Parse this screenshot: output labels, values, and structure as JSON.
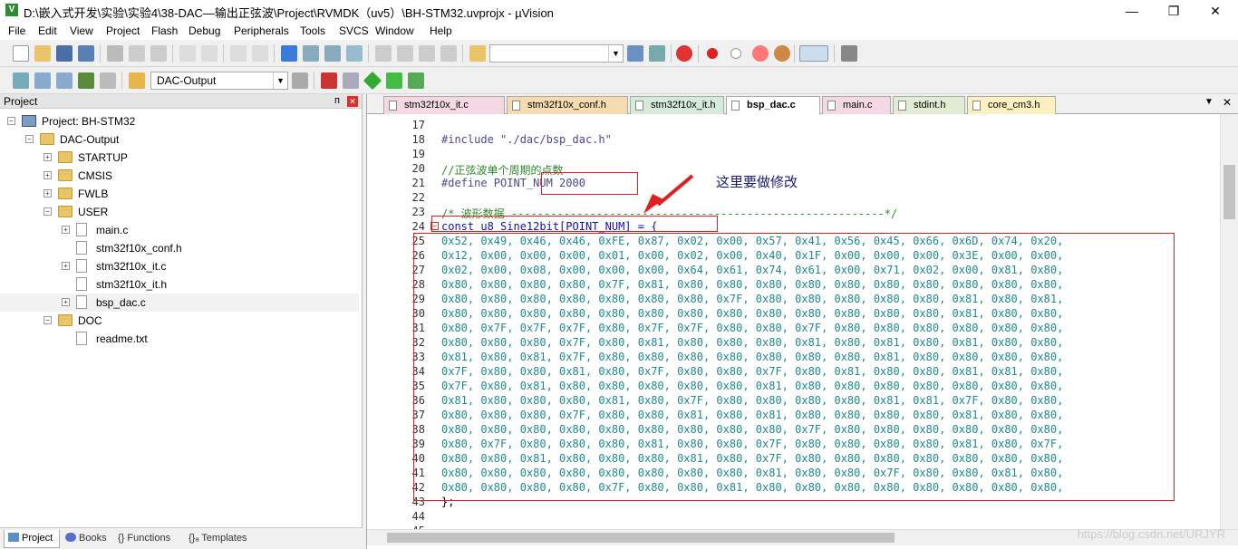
{
  "window": {
    "title": "D:\\嵌入式开发\\实验\\实验4\\38-DAC—输出正弦波\\Project\\RVMDK（uv5）\\BH-STM32.uvprojx - µVision",
    "minimize": "—",
    "restore": "❐",
    "close": "✕"
  },
  "menu": [
    "File",
    "Edit",
    "View",
    "Project",
    "Flash",
    "Debug",
    "Peripherals",
    "Tools",
    "SVCS",
    "Window",
    "Help"
  ],
  "toolbar": {
    "target_select": "DAC-Output"
  },
  "project_panel": {
    "title": "Project",
    "pin": "ᴨ",
    "close": "✕",
    "tree": [
      {
        "label": "Project: BH-STM32",
        "level": 0,
        "expand": "−",
        "icon": "project-icon"
      },
      {
        "label": "DAC-Output",
        "level": 1,
        "expand": "−",
        "icon": "folder-icon"
      },
      {
        "label": "STARTUP",
        "level": 2,
        "expand": "+",
        "icon": "folder-icon"
      },
      {
        "label": "CMSIS",
        "level": 2,
        "expand": "+",
        "icon": "folder-icon"
      },
      {
        "label": "FWLB",
        "level": 2,
        "expand": "+",
        "icon": "folder-icon"
      },
      {
        "label": "USER",
        "level": 2,
        "expand": "−",
        "icon": "folder-icon"
      },
      {
        "label": "main.c",
        "level": 3,
        "expand": "+",
        "icon": "file-icon"
      },
      {
        "label": "stm32f10x_conf.h",
        "level": 3,
        "expand": "",
        "icon": "file-icon"
      },
      {
        "label": "stm32f10x_it.c",
        "level": 3,
        "expand": "+",
        "icon": "file-icon"
      },
      {
        "label": "stm32f10x_it.h",
        "level": 3,
        "expand": "",
        "icon": "file-icon"
      },
      {
        "label": "bsp_dac.c",
        "level": 3,
        "expand": "+",
        "icon": "file-icon"
      },
      {
        "label": "DOC",
        "level": 2,
        "expand": "−",
        "icon": "folder-icon"
      },
      {
        "label": "readme.txt",
        "level": 3,
        "expand": "",
        "icon": "file-icon"
      }
    ],
    "bottom_tabs": [
      "Project",
      "Books",
      "{} Functions",
      "{}ₐ Templates"
    ]
  },
  "editor": {
    "tabs": [
      {
        "label": "stm32f10x_it.c",
        "color": "#f4d9e4"
      },
      {
        "label": "stm32f10x_conf.h",
        "color": "#f7dbb0"
      },
      {
        "label": "stm32f10x_it.h",
        "color": "#d5ead9"
      },
      {
        "label": "bsp_dac.c",
        "color": "#ffffff",
        "active": true
      },
      {
        "label": "main.c",
        "color": "#f4d9e4"
      },
      {
        "label": "stdint.h",
        "color": "#e2ecd2"
      },
      {
        "label": "core_cm3.h",
        "color": "#fbf0c0"
      }
    ],
    "lines": [
      {
        "n": "17",
        "text": "",
        "cls": "c-plain"
      },
      {
        "n": "18",
        "text": "#include \"./dac/bsp_dac.h\"",
        "cls": "c-pre"
      },
      {
        "n": "19",
        "text": "",
        "cls": "c-plain"
      },
      {
        "n": "20",
        "text": "//正弦波单个周期的点数",
        "cls": "c-comment"
      },
      {
        "n": "21",
        "text": "#define POINT_NUM 2000",
        "cls": "c-pre"
      },
      {
        "n": "22",
        "text": "",
        "cls": "c-plain"
      },
      {
        "n": "23",
        "text": "/* 波形数据 ---------------------------------------------------------*/",
        "cls": "c-comment"
      },
      {
        "n": "24",
        "text": "const u8 Sine12bit[POINT_NUM] = {",
        "cls": "c-kw",
        "fold": "−"
      },
      {
        "n": "25",
        "text": "0x52, 0x49, 0x46, 0x46, 0xFE, 0x87, 0x02, 0x00, 0x57, 0x41, 0x56, 0x45, 0x66, 0x6D, 0x74, 0x20,",
        "cls": "c-hex"
      },
      {
        "n": "26",
        "text": "0x12, 0x00, 0x00, 0x00, 0x01, 0x00, 0x02, 0x00, 0x40, 0x1F, 0x00, 0x00, 0x00, 0x3E, 0x00, 0x00,",
        "cls": "c-hex"
      },
      {
        "n": "27",
        "text": "0x02, 0x00, 0x08, 0x00, 0x00, 0x00, 0x64, 0x61, 0x74, 0x61, 0x00, 0x71, 0x02, 0x00, 0x81, 0x80,",
        "cls": "c-hex"
      },
      {
        "n": "28",
        "text": "0x80, 0x80, 0x80, 0x80, 0x7F, 0x81, 0x80, 0x80, 0x80, 0x80, 0x80, 0x80, 0x80, 0x80, 0x80, 0x80,",
        "cls": "c-hex"
      },
      {
        "n": "29",
        "text": "0x80, 0x80, 0x80, 0x80, 0x80, 0x80, 0x80, 0x7F, 0x80, 0x80, 0x80, 0x80, 0x80, 0x81, 0x80, 0x81,",
        "cls": "c-hex"
      },
      {
        "n": "30",
        "text": "0x80, 0x80, 0x80, 0x80, 0x80, 0x80, 0x80, 0x80, 0x80, 0x80, 0x80, 0x80, 0x80, 0x81, 0x80, 0x80,",
        "cls": "c-hex"
      },
      {
        "n": "31",
        "text": "0x80, 0x7F, 0x7F, 0x7F, 0x80, 0x7F, 0x7F, 0x80, 0x80, 0x7F, 0x80, 0x80, 0x80, 0x80, 0x80, 0x80,",
        "cls": "c-hex"
      },
      {
        "n": "32",
        "text": "0x80, 0x80, 0x80, 0x7F, 0x80, 0x81, 0x80, 0x80, 0x80, 0x81, 0x80, 0x81, 0x80, 0x81, 0x80, 0x80,",
        "cls": "c-hex"
      },
      {
        "n": "33",
        "text": "0x81, 0x80, 0x81, 0x7F, 0x80, 0x80, 0x80, 0x80, 0x80, 0x80, 0x80, 0x81, 0x80, 0x80, 0x80, 0x80,",
        "cls": "c-hex"
      },
      {
        "n": "34",
        "text": "0x7F, 0x80, 0x80, 0x81, 0x80, 0x7F, 0x80, 0x80, 0x7F, 0x80, 0x81, 0x80, 0x80, 0x81, 0x81, 0x80,",
        "cls": "c-hex"
      },
      {
        "n": "35",
        "text": "0x7F, 0x80, 0x81, 0x80, 0x80, 0x80, 0x80, 0x80, 0x81, 0x80, 0x80, 0x80, 0x80, 0x80, 0x80, 0x80,",
        "cls": "c-hex"
      },
      {
        "n": "36",
        "text": "0x81, 0x80, 0x80, 0x80, 0x81, 0x80, 0x7F, 0x80, 0x80, 0x80, 0x80, 0x81, 0x81, 0x7F, 0x80, 0x80,",
        "cls": "c-hex"
      },
      {
        "n": "37",
        "text": "0x80, 0x80, 0x80, 0x7F, 0x80, 0x80, 0x81, 0x80, 0x81, 0x80, 0x80, 0x80, 0x80, 0x81, 0x80, 0x80,",
        "cls": "c-hex"
      },
      {
        "n": "38",
        "text": "0x80, 0x80, 0x80, 0x80, 0x80, 0x80, 0x80, 0x80, 0x80, 0x7F, 0x80, 0x80, 0x80, 0x80, 0x80, 0x80,",
        "cls": "c-hex"
      },
      {
        "n": "39",
        "text": "0x80, 0x7F, 0x80, 0x80, 0x80, 0x81, 0x80, 0x80, 0x7F, 0x80, 0x80, 0x80, 0x80, 0x81, 0x80, 0x7F,",
        "cls": "c-hex"
      },
      {
        "n": "40",
        "text": "0x80, 0x80, 0x81, 0x80, 0x80, 0x80, 0x81, 0x80, 0x7F, 0x80, 0x80, 0x80, 0x80, 0x80, 0x80, 0x80,",
        "cls": "c-hex"
      },
      {
        "n": "41",
        "text": "0x80, 0x80, 0x80, 0x80, 0x80, 0x80, 0x80, 0x80, 0x81, 0x80, 0x80, 0x7F, 0x80, 0x80, 0x81, 0x80,",
        "cls": "c-hex"
      },
      {
        "n": "42",
        "text": "0x80, 0x80, 0x80, 0x80, 0x7F, 0x80, 0x80, 0x81, 0x80, 0x80, 0x80, 0x80, 0x80, 0x80, 0x80, 0x80,",
        "cls": "c-hex"
      },
      {
        "n": "43",
        "text": "};",
        "cls": "c-plain"
      },
      {
        "n": "44",
        "text": "",
        "cls": "c-plain"
      },
      {
        "n": "45",
        "text": "",
        "cls": "c-plain"
      }
    ]
  },
  "annotation": {
    "text": "这里要做修改",
    "color": "#e02020"
  },
  "watermark": "https://blog.csdn.net/URJYR"
}
